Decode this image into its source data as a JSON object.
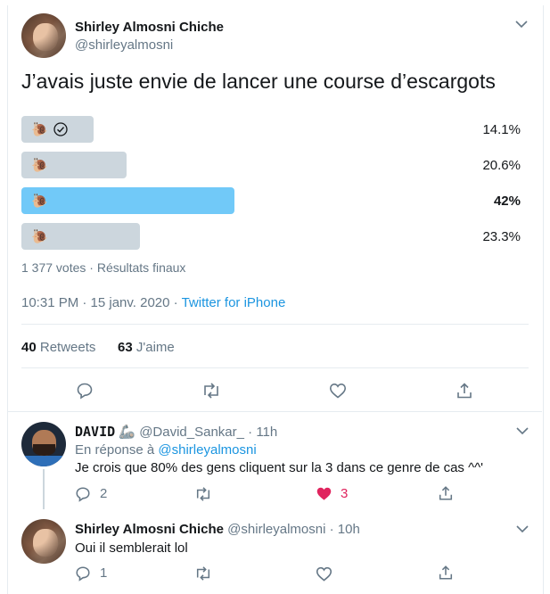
{
  "tweet": {
    "author_name": "Shirley Almosni Chiche",
    "author_handle": "@shirleyalmosni",
    "text": "J’avais juste envie de lancer une course d’escargots",
    "poll": {
      "options": [
        {
          "emoji": "🐌",
          "percent_label": "14.1%",
          "percent": 14.1,
          "selected": true,
          "winner": false
        },
        {
          "emoji": "🐌",
          "percent_label": "20.6%",
          "percent": 20.6,
          "selected": false,
          "winner": false
        },
        {
          "emoji": "🐌",
          "percent_label": "42%",
          "percent": 42,
          "selected": false,
          "winner": true
        },
        {
          "emoji": "🐌",
          "percent_label": "23.3%",
          "percent": 23.3,
          "selected": false,
          "winner": false
        }
      ],
      "summary": "1 377 votes · Résultats finaux"
    },
    "timestamp": "10:31 PM · 15 janv. 2020",
    "timestamp_sep": " · ",
    "source": "Twitter for iPhone",
    "retweets_count": "40",
    "retweets_label": "Retweets",
    "likes_count": "63",
    "likes_label": "J'aime"
  },
  "replies": [
    {
      "author_name": "DAVID",
      "author_emoji": "🦾",
      "author_handle": "@David_Sankar_",
      "time": "· 11h",
      "reply_to_prefix": "En réponse à",
      "reply_to_handle": "@shirleyalmosni",
      "text": "Je crois que 80% des gens cliquent sur la 3 dans ce genre de cas ^^'",
      "reply_count": "2",
      "like_count": "3",
      "liked": true
    },
    {
      "author_name": "Shirley Almosni Chiche",
      "author_handle": "@shirleyalmosni",
      "time": "· 10h",
      "text": "Oui il semblerait lol",
      "reply_count": "1"
    }
  ],
  "colors": {
    "accent": "#1da1f2",
    "winner_bar": "#71c9f8",
    "bar": "#ccd6dd",
    "like_red": "#e0245e",
    "muted": "#657786"
  }
}
